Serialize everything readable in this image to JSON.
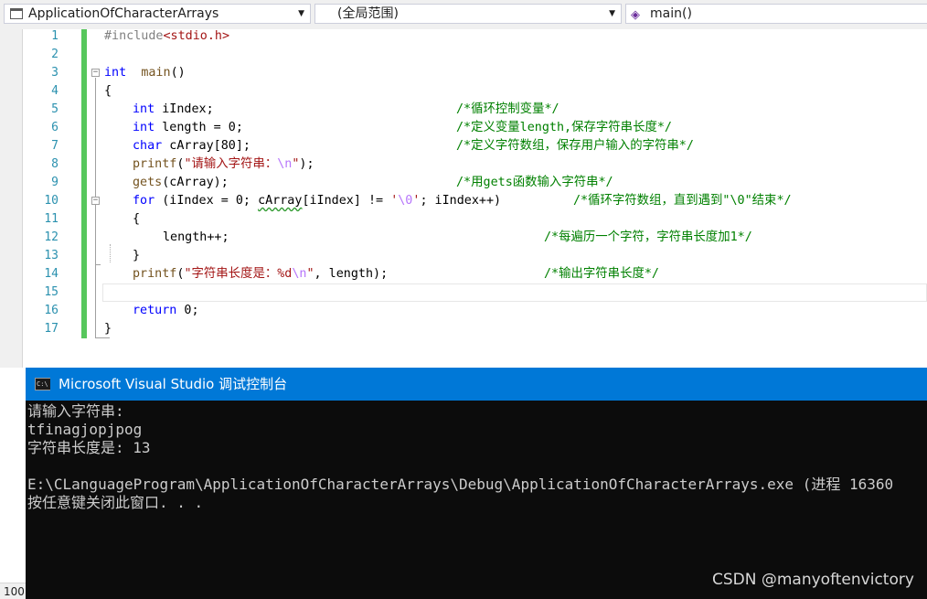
{
  "navbar": {
    "project": "ApplicationOfCharacterArrays",
    "scope": "(全局范围)",
    "member": "main()"
  },
  "editor": {
    "line_numbers": [
      "1",
      "2",
      "3",
      "4",
      "5",
      "6",
      "7",
      "8",
      "9",
      "10",
      "11",
      "12",
      "13",
      "14",
      "15",
      "16",
      "17"
    ],
    "lines": {
      "l1_pp": "#include",
      "l1_hdr": "<stdio.h>",
      "l3_kw": "int",
      "l3_fn": "main",
      "l3_rest": "()",
      "l4": "{",
      "l5_kw": "int",
      "l5_rest": " iIndex;",
      "l5_cm": "/*循环控制变量*/",
      "l6_kw": "int",
      "l6_rest": " length = 0;",
      "l6_cm": "/*定义变量length,保存字符串长度*/",
      "l7_kw": "char",
      "l7_rest": " cArray[80];",
      "l7_cm": "/*定义字符数组，保存用户输入的字符串*/",
      "l8_fn": "printf",
      "l8_p1": "(",
      "l8_str": "\"请输入字符串：",
      "l8_esc": "\\n",
      "l8_str2": "\"",
      "l8_p2": ");",
      "l9_fn": "gets",
      "l9_rest": "(cArray);",
      "l9_cm": "/*用gets函数输入字符串*/",
      "l10_kw": "for",
      "l10_a": " (iIndex = 0; ",
      "l10_sq": "cArray",
      "l10_b": "[iIndex] != ",
      "l10_c1": "'",
      "l10_esc": "\\0",
      "l10_c2": "'",
      "l10_d": "; iIndex++)",
      "l10_cm": "/*循环字符数组，直到遇到\"\\0\"结束*/",
      "l11": "{",
      "l12": "length++;",
      "l12_cm": "/*每遍历一个字符，字符串长度加1*/",
      "l13": "}",
      "l14_fn": "printf",
      "l14_p1": "(",
      "l14_str": "\"字符串长度是：%d",
      "l14_esc": "\\n",
      "l14_str2": "\"",
      "l14_rest": ", length);",
      "l14_cm": "/*输出字符串长度*/",
      "l16_kw": "return",
      "l16_rest": " 0;",
      "l17": "}"
    }
  },
  "console": {
    "title": "Microsoft Visual Studio 调试控制台",
    "icon_text": "C:\\",
    "lines": [
      "请输入字符串:",
      "tfinagjopjpog",
      "字符串长度是: 13",
      "",
      "E:\\CLanguageProgram\\ApplicationOfCharacterArrays\\Debug\\ApplicationOfCharacterArrays.exe (进程 16360",
      "按任意键关闭此窗口. . ."
    ]
  },
  "zoom": "100",
  "watermark": "CSDN @manyoftenvictory"
}
